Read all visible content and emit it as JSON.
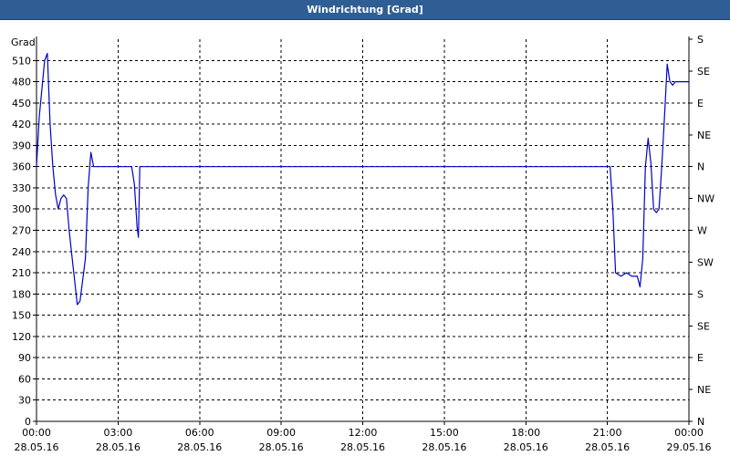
{
  "window": {
    "title": "Windrichtung [Grad]"
  },
  "chart_data": {
    "type": "line",
    "title": "Windrichtung [Grad]",
    "ylabel": "Grad",
    "ylim": [
      0,
      540
    ],
    "xlim_hours": [
      0,
      24
    ],
    "y_ticks": [
      0,
      30,
      60,
      90,
      120,
      150,
      180,
      210,
      240,
      270,
      300,
      330,
      360,
      390,
      420,
      450,
      480,
      510
    ],
    "right_axis_labels": [
      {
        "value": 0,
        "label": "N"
      },
      {
        "value": 45,
        "label": "NE"
      },
      {
        "value": 90,
        "label": "E"
      },
      {
        "value": 135,
        "label": "SE"
      },
      {
        "value": 180,
        "label": "S"
      },
      {
        "value": 225,
        "label": "SW"
      },
      {
        "value": 270,
        "label": "W"
      },
      {
        "value": 315,
        "label": "NW"
      },
      {
        "value": 360,
        "label": "N"
      },
      {
        "value": 405,
        "label": "NE"
      },
      {
        "value": 450,
        "label": "E"
      },
      {
        "value": 495,
        "label": "SE"
      },
      {
        "value": 540,
        "label": "S"
      }
    ],
    "x_ticks": [
      {
        "hour": 0,
        "time": "00:00",
        "date": "28.05.16"
      },
      {
        "hour": 3,
        "time": "03:00",
        "date": "28.05.16"
      },
      {
        "hour": 6,
        "time": "06:00",
        "date": "28.05.16"
      },
      {
        "hour": 9,
        "time": "09:00",
        "date": "28.05.16"
      },
      {
        "hour": 12,
        "time": "12:00",
        "date": "28.05.16"
      },
      {
        "hour": 15,
        "time": "15:00",
        "date": "28.05.16"
      },
      {
        "hour": 18,
        "time": "18:00",
        "date": "28.05.16"
      },
      {
        "hour": 21,
        "time": "21:00",
        "date": "28.05.16"
      },
      {
        "hour": 24,
        "time": "00:00",
        "date": "29.05.16"
      }
    ],
    "grid": true,
    "line_color": "#0000cc",
    "series": [
      {
        "x": [
          0.0,
          0.1,
          0.3,
          0.4,
          0.5,
          0.6,
          0.7,
          0.8,
          0.9,
          1.0,
          1.1,
          1.2,
          1.3,
          1.4,
          1.5,
          1.6,
          1.8,
          1.9,
          2.0,
          2.1,
          2.2,
          2.3,
          2.4,
          2.5,
          2.6,
          2.7,
          2.8,
          3.0,
          3.2,
          3.4,
          3.5,
          3.6,
          3.7,
          3.75,
          3.8,
          3.9,
          4.0,
          5.0,
          6.0,
          8.0,
          10.0,
          12.0,
          14.0,
          16.0,
          18.0,
          20.0,
          21.0,
          21.1,
          21.2,
          21.3,
          21.5,
          21.7,
          21.9,
          22.1,
          22.2,
          22.3,
          22.4,
          22.5,
          22.6,
          22.7,
          22.8,
          22.9,
          23.0,
          23.1,
          23.2,
          23.3,
          23.4,
          23.5,
          23.6,
          23.7,
          23.8,
          23.9,
          24.0
        ],
        "y": [
          360,
          430,
          510,
          520,
          420,
          360,
          320,
          300,
          315,
          320,
          315,
          270,
          235,
          200,
          165,
          170,
          230,
          330,
          380,
          360,
          360,
          360,
          360,
          360,
          360,
          360,
          360,
          360,
          360,
          360,
          360,
          335,
          275,
          260,
          360,
          360,
          360,
          360,
          360,
          360,
          360,
          360,
          360,
          360,
          360,
          360,
          360,
          360,
          300,
          210,
          205,
          210,
          205,
          205,
          190,
          230,
          360,
          400,
          365,
          300,
          295,
          300,
          360,
          430,
          505,
          480,
          475,
          480,
          480,
          480,
          480,
          480,
          480
        ]
      }
    ]
  }
}
